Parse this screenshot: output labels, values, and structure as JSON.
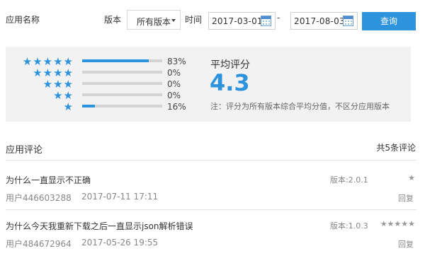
{
  "filter": {
    "app_name_label": "应用名称",
    "app_name_value": "",
    "version_label": "版本",
    "version_selected": "所有版本",
    "time_label": "时间",
    "date_start": "2017-03-01",
    "date_separator": "-",
    "date_end": "2017-08-03",
    "query_label": "查询"
  },
  "rating": {
    "rows": [
      {
        "stars": "★★★★★",
        "percent_label": "83%",
        "fraction": 0.83
      },
      {
        "stars": "★★★★",
        "percent_label": "0%",
        "fraction": 0
      },
      {
        "stars": "★★★",
        "percent_label": "0%",
        "fraction": 0
      },
      {
        "stars": "★★",
        "percent_label": "0%",
        "fraction": 0
      },
      {
        "stars": "★",
        "percent_label": "16%",
        "fraction": 0.16
      }
    ],
    "average_title": "平均评分",
    "average_value": "4.3",
    "note": "注：评分为所有版本综合平均分值，不区分应用版本",
    "accent_color": "#2d93dd"
  },
  "comments": {
    "title": "应用评论",
    "count_label": "共5条评论",
    "items": [
      {
        "text": "为什么一直显示不正确",
        "user": "用户446603288",
        "time": "2017-07-11 17:11",
        "version": "版本:2.0.1",
        "stars": "★",
        "reply_label": "回复"
      },
      {
        "text": "为什么今天我重新下载之后一直显示json解析错误",
        "user": "用户484672964",
        "time": "2017-05-26 19:55",
        "version": "版本:1.0.3",
        "stars": "★★★★★",
        "reply_label": "回复"
      }
    ]
  }
}
